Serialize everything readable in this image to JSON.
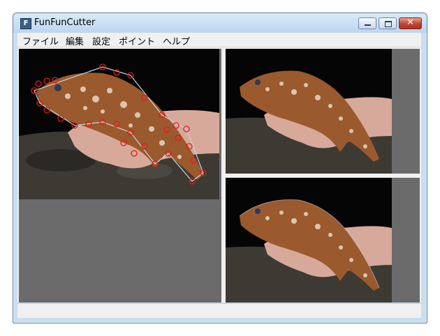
{
  "window": {
    "title": "FunFunCutter",
    "app_icon_letter": "F",
    "close_glyph": "✕"
  },
  "menu": [
    "ファイル",
    "編集",
    "設定",
    "ポイント",
    "ヘルプ"
  ],
  "panes": {
    "main": {
      "content": "fish photo with red control points and cut outline"
    },
    "top_right": {
      "content": "fish photo preview"
    },
    "bottom_right": {
      "content": "fish photo cutout preview"
    }
  },
  "colors": {
    "pane_background": "#6b6b6b",
    "control_point": "#e21b1b",
    "outline": "#c9d3e0"
  },
  "icons": [
    "app-icon",
    "minimize-icon",
    "maximize-icon",
    "close-icon"
  ]
}
